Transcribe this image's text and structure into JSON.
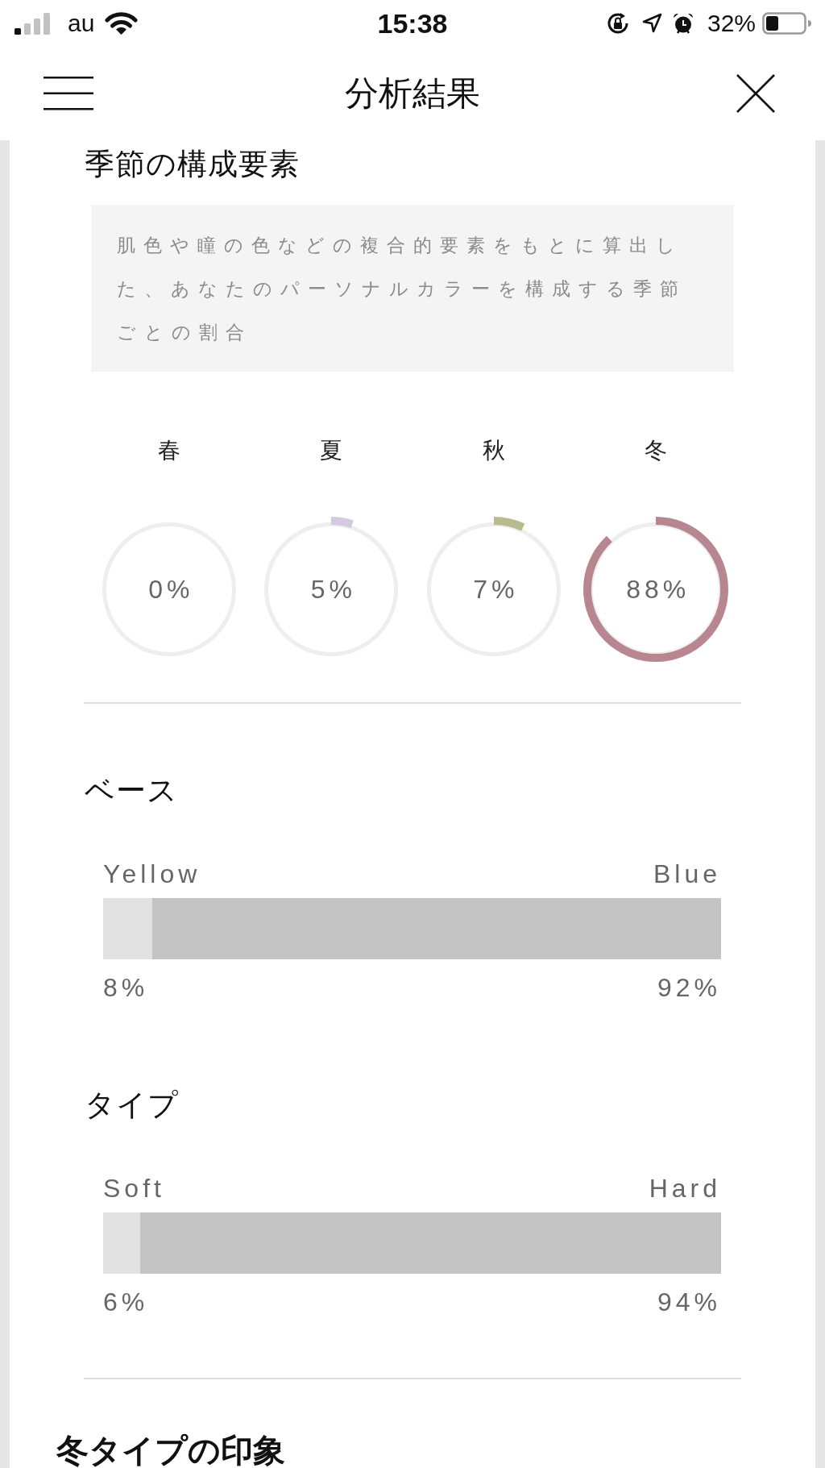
{
  "status_bar": {
    "carrier": "au",
    "time": "15:38",
    "battery": "32%"
  },
  "nav": {
    "title": "分析結果"
  },
  "composition": {
    "title": "季節の構成要素",
    "description": "肌色や瞳の色などの複合的要素をもとに算出した、あなたのパーソナルカラーを構成する季節ごとの割合",
    "seasons": [
      {
        "label": "春",
        "reading": "0%",
        "level": 0
      },
      {
        "label": "夏",
        "reading": "5%",
        "level": 0.05,
        "color": "#d3c9e1"
      },
      {
        "label": "秋",
        "reading": "7%",
        "level": 0.07,
        "color": "#b7bb8e"
      },
      {
        "label": "冬",
        "reading": "88%",
        "level": 0.88,
        "color": "#b88691"
      }
    ]
  },
  "scales": [
    {
      "title": "ベース",
      "left_label": "Yellow",
      "right_label": "Blue",
      "left_reading": "8%",
      "right_reading": "92%",
      "level": 0.92
    },
    {
      "title": "タイプ",
      "left_label": "Soft",
      "right_label": "Hard",
      "left_reading": "6%",
      "right_reading": "94%",
      "level": 0.94
    }
  ],
  "impression": {
    "title": "冬タイプの印象"
  }
}
